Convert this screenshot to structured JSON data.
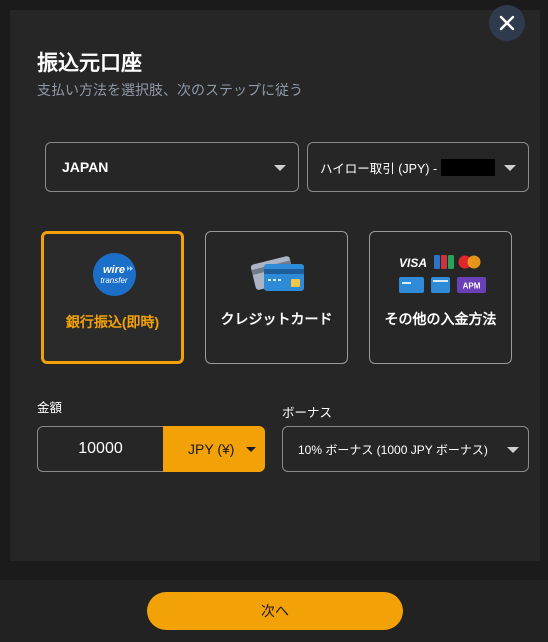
{
  "header": {
    "title": "振込元口座",
    "subtitle": "支払い方法を選択肢、次のステップに従う"
  },
  "country_select": {
    "value": "JAPAN"
  },
  "account_select": {
    "value": "ハイロー取引 (JPY) -"
  },
  "payment_methods": [
    {
      "label": "銀行振込(即時)",
      "icon": "wire-transfer-icon",
      "logo_text": [
        "wire",
        "transfer"
      ],
      "selected": true
    },
    {
      "label": "クレジットカード",
      "icon": "credit-card-icon",
      "selected": false
    },
    {
      "label": "その他の入金方法",
      "icon": "other-payment-icons",
      "logo_text": [
        "VISA",
        "APM"
      ],
      "selected": false
    }
  ],
  "amount": {
    "label": "金額",
    "value": "10000"
  },
  "currency": {
    "value": "JPY (¥)"
  },
  "bonus": {
    "label": "ボーナス",
    "value": "10% ボーナス (1000 JPY ボーナス)"
  },
  "footer": {
    "next_label": "次へ"
  },
  "colors": {
    "accent": "#f2a106",
    "modal_bg": "#262626",
    "page_bg": "#1b1b1b",
    "subtitle": "#8f99a8"
  }
}
